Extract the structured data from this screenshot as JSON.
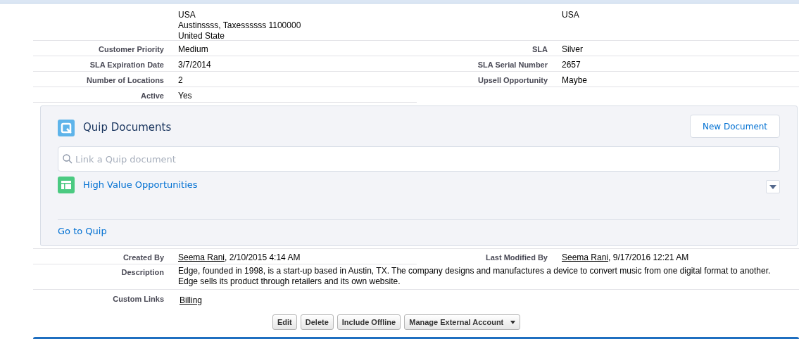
{
  "address": {
    "left_lines": [
      "USA",
      "Austinssss, Taxessssss 1100000",
      "United State"
    ],
    "right_lines": [
      "USA"
    ]
  },
  "fields": [
    {
      "left": {
        "label": "Customer Priority",
        "value": "Medium"
      },
      "right": {
        "label": "SLA",
        "value": "Silver"
      }
    },
    {
      "left": {
        "label": "SLA Expiration Date",
        "value": "3/7/2014"
      },
      "right": {
        "label": "SLA Serial Number",
        "value": "2657"
      }
    },
    {
      "left": {
        "label": "Number of Locations",
        "value": "2"
      },
      "right": {
        "label": "Upsell Opportunity",
        "value": "Maybe"
      }
    },
    {
      "left": {
        "label": "Active",
        "value": "Yes"
      }
    }
  ],
  "quip": {
    "title": "Quip Documents",
    "new_button": "New Document",
    "search_placeholder": "Link a Quip document",
    "documents": [
      {
        "title": "High Value Opportunities"
      }
    ],
    "footer_link": "Go to Quip"
  },
  "created_by": {
    "label": "Created By",
    "user": "Seema Rani",
    "date": ", 2/10/2015 4:14 AM"
  },
  "last_modified_by": {
    "label": "Last Modified By",
    "user": "Seema Rani",
    "date": ", 9/17/2016 12:21 AM"
  },
  "description": {
    "label": "Description",
    "text": "Edge, founded in 1998, is a start-up based in Austin, TX. The company designs and manufactures a device to convert music from one digital format to another. Edge sells its product through retailers and its own website."
  },
  "custom_links": {
    "label": "Custom Links",
    "links": [
      "Billing"
    ]
  },
  "buttons": [
    {
      "label": "Edit",
      "kind": "plain"
    },
    {
      "label": "Delete",
      "kind": "plain"
    },
    {
      "label": "Include Offline",
      "kind": "plain"
    },
    {
      "label": "Manage External Account",
      "kind": "menu"
    }
  ]
}
